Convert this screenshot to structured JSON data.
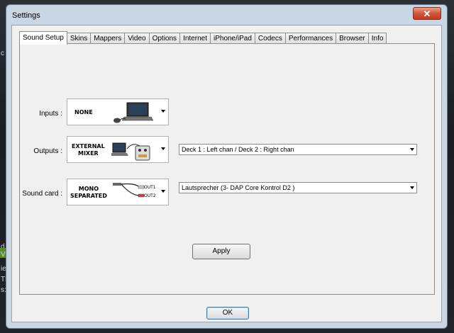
{
  "window": {
    "title": "Settings",
    "close_glyph": "✕"
  },
  "tabs": [
    {
      "label": "Sound Setup",
      "active": true
    },
    {
      "label": "Skins"
    },
    {
      "label": "Mappers"
    },
    {
      "label": "Video"
    },
    {
      "label": "Options"
    },
    {
      "label": "Internet"
    },
    {
      "label": "iPhone/iPad"
    },
    {
      "label": "Codecs"
    },
    {
      "label": "Performances"
    },
    {
      "label": "Browser"
    },
    {
      "label": "Info"
    }
  ],
  "sound_setup": {
    "inputs": {
      "label": "Inputs :",
      "device": "NONE",
      "icon": "laptop-with-mouse-icon"
    },
    "outputs": {
      "label": "Outputs :",
      "device_line1": "EXTERNAL",
      "device_line2": "MIXER",
      "icon": "laptop-with-mixer-icon",
      "channel_select": "Deck 1 : Left chan / Deck 2 : Right chan"
    },
    "sound_card": {
      "label": "Sound card :",
      "device_line1": "MONO",
      "device_line2": "SEPARATED",
      "icon": "rca-cables-icon",
      "out1": "OUT1",
      "out2": "OUT2",
      "card_select": "Lautsprecher (3- DAP Core Kontrol D2 )"
    },
    "apply_label": "Apply"
  },
  "footer": {
    "ok_label": "OK"
  },
  "background": {
    "text_lines": [
      "c",
      "d",
      "V",
      "ie",
      "Th",
      "s:"
    ]
  },
  "colors": {
    "client_bg": "#f0f0f0",
    "frame": "#c9d6e3",
    "close": "#c23b21",
    "bg_accent": "#5a8a2a"
  }
}
